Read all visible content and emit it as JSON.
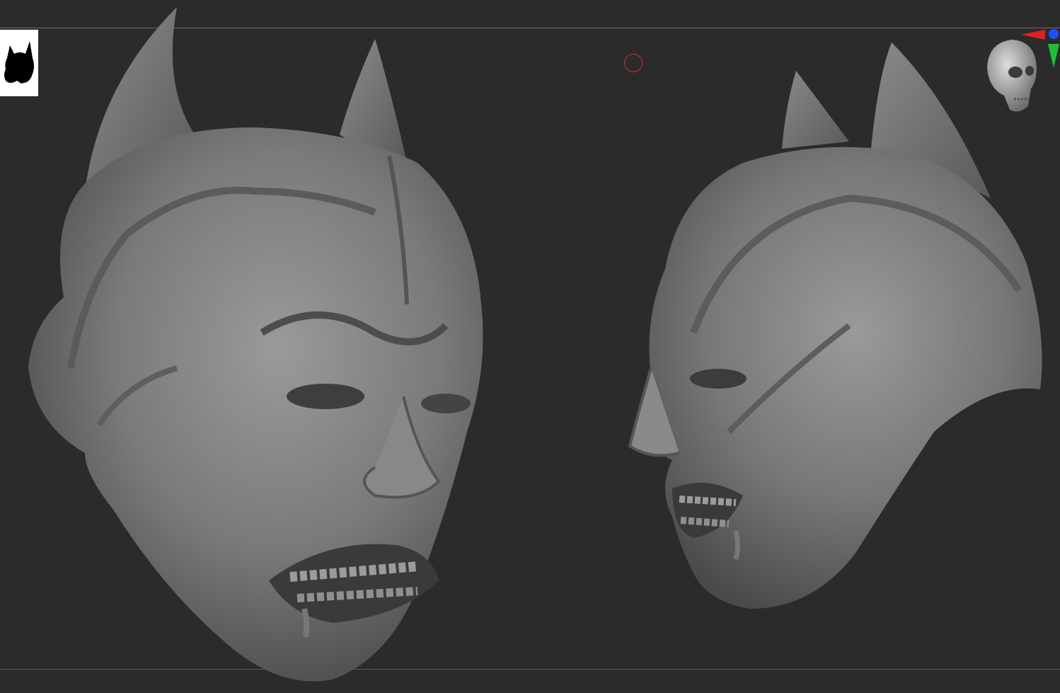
{
  "app": {
    "window_title": ""
  },
  "viewport": {
    "background": "#2b2b2b",
    "frame_line_color": "#6a6a6a"
  },
  "thumbnail": {
    "icon": "batman-silhouette-icon"
  },
  "cursor": {
    "icon": "brush-cursor-ring-icon",
    "color": "#c0392b"
  },
  "models": [
    {
      "name": "demon-batman-head-front-three-quarter",
      "icon": "sculpted-head-icon"
    },
    {
      "name": "demon-batman-head-profile",
      "icon": "sculpted-head-icon"
    }
  ],
  "navigator": {
    "icon": "skull-navigator-icon",
    "axis_colors": {
      "x": "#e02020",
      "y": "#1fbf3a",
      "z": "#1f4fff"
    }
  }
}
